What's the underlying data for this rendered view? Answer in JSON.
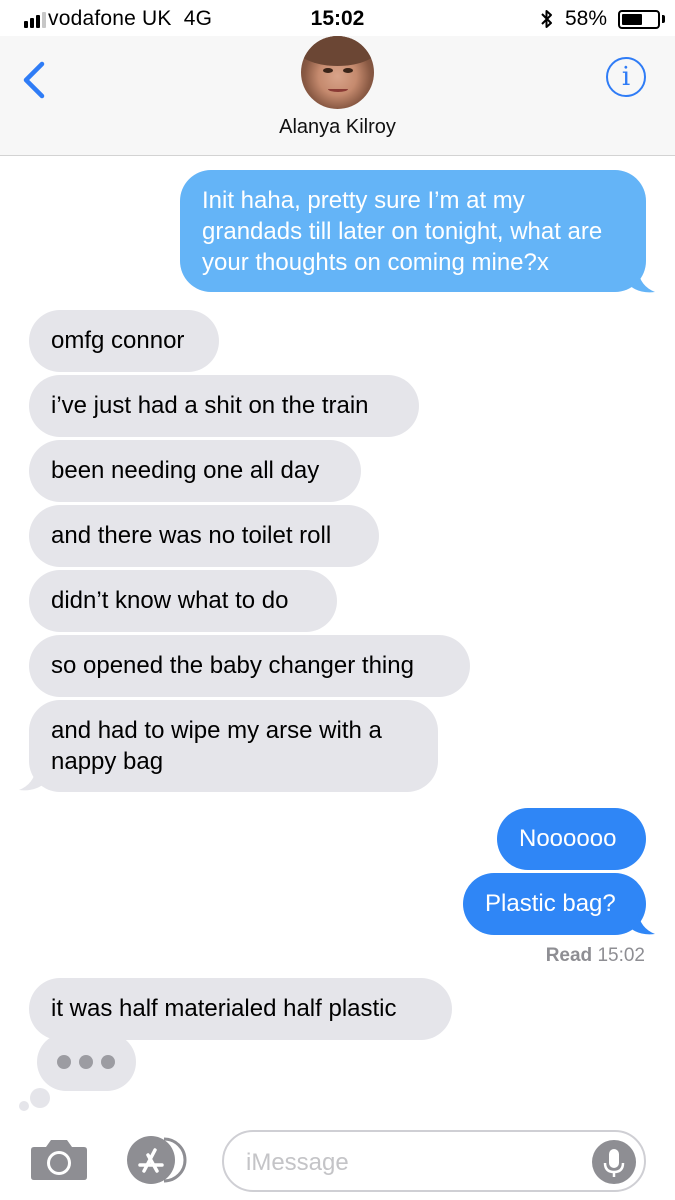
{
  "status_bar": {
    "carrier": "vodafone UK",
    "network": "4G",
    "time": "15:02",
    "battery_percent": "58%",
    "battery_level": 0.58,
    "signal_bars_filled": 3,
    "signal_bars_total": 4,
    "icons": [
      "signal-icon",
      "bluetooth-icon",
      "battery-icon"
    ]
  },
  "header": {
    "contact_name": "Alanya Kilroy",
    "back_icon": "chevron-left-icon",
    "info_icon": "info-icon",
    "info_glyph": "i"
  },
  "messages": [
    {
      "direction": "sent",
      "text": "Init haha, pretty sure I’m at my grandads till later on tonight, what are your thoughts on coming mine?x"
    },
    {
      "direction": "received",
      "text": "omfg connor"
    },
    {
      "direction": "received",
      "text": "i’ve just had a shit on the train"
    },
    {
      "direction": "received",
      "text": "been needing one all day"
    },
    {
      "direction": "received",
      "text": "and there was no toilet roll"
    },
    {
      "direction": "received",
      "text": "didn’t know what to do"
    },
    {
      "direction": "received",
      "text": "so opened the baby changer thing"
    },
    {
      "direction": "received",
      "text": "and had to wipe my arse with a nappy bag"
    },
    {
      "direction": "sent",
      "text": "Noooooo"
    },
    {
      "direction": "sent",
      "text": "Plastic bag?"
    },
    {
      "direction": "received",
      "text": "it was half materialed half plastic"
    }
  ],
  "read_receipt": {
    "label": "Read",
    "time": "15:02"
  },
  "typing_indicator": {
    "visible": true
  },
  "input_bar": {
    "placeholder": "iMessage",
    "icons": [
      "camera-icon",
      "app-store-icon",
      "microphone-icon"
    ]
  },
  "colors": {
    "sent_bubble": "#2f86f6",
    "sent_bubble_faded": "#64b4f7",
    "received_bubble": "#e5e5ea",
    "accent": "#2f7cf6"
  }
}
